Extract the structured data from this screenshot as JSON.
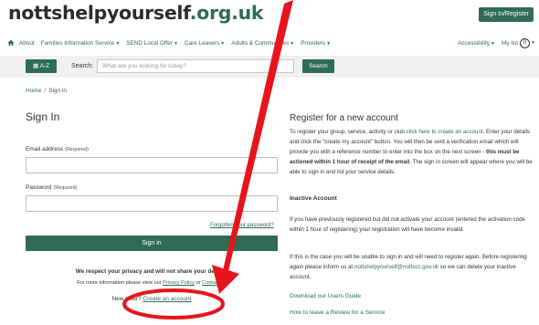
{
  "header": {
    "logo_name": "nottshelpyourself",
    "logo_tld": ".org.uk",
    "signin_register_label": "Sign In/Register"
  },
  "nav": {
    "items": [
      {
        "label": "About",
        "dropdown": false
      },
      {
        "label": "Families Information Service",
        "dropdown": true
      },
      {
        "label": "SEND Local Offer",
        "dropdown": true
      },
      {
        "label": "Care Leavers",
        "dropdown": true
      },
      {
        "label": "Adults & Communities",
        "dropdown": true
      },
      {
        "label": "Providers",
        "dropdown": true
      }
    ],
    "accessibility_label": "Accessibility",
    "mylist_label": "My list",
    "mylist_count": "0"
  },
  "search": {
    "az_label": "A-Z",
    "label": "Search:",
    "placeholder": "What are you looking for today?",
    "button_label": "Search"
  },
  "breadcrumb": {
    "home": "Home",
    "separator": "/",
    "current": "Sign in"
  },
  "signin": {
    "title": "Sign In",
    "email_label": "Email address",
    "required": "(Required)",
    "password_label": "Password",
    "forgot_link": "Forgotten your password?",
    "button_label": "Sign in",
    "privacy_bold": "We respect your privacy and will not share your details.",
    "privacy_info_prefix": "For more information please view our",
    "privacy_policy_link": "Privacy Policy",
    "privacy_or": "or",
    "contact_link": "Contact us",
    "new_user_prefix": "New User?",
    "create_account_link": "Create an account"
  },
  "register": {
    "title": "Register for a new account",
    "p1_a": "To register your group, service, activity or club",
    "p1_link": "click here to create an account",
    "p1_b": ". Enter your details and click the \"create my account\" button. You will then be sent a verification email which will provide you with a reference number to enter into the box on the next screen -",
    "p1_bold": "this must be actioned within 1 hour of receipt of the email",
    "p1_c": ". The sign in screen will appear where you will be able to sign in and list your service details.",
    "inactive_heading": "Inactive Account",
    "p2": "If you have previously registered but did not activate your account (entered the activation code within 1 hour of registering) your registration will have become invalid.",
    "p3_a": "If this is the case you will be unable to sign in and will need to register again. Before registering again please inform us at",
    "p3_email": "nottshelpyourself@nottscc.gov.uk",
    "p3_b": "so we can delete your inactive account.",
    "download_guide_link": "Download our Users Guide",
    "review_link": "How to leave a Review for a Service"
  },
  "annotation": {
    "color": "#e8141c"
  },
  "colors": {
    "brand_green": "#2f6b56",
    "search_band": "#f0f0f0"
  }
}
